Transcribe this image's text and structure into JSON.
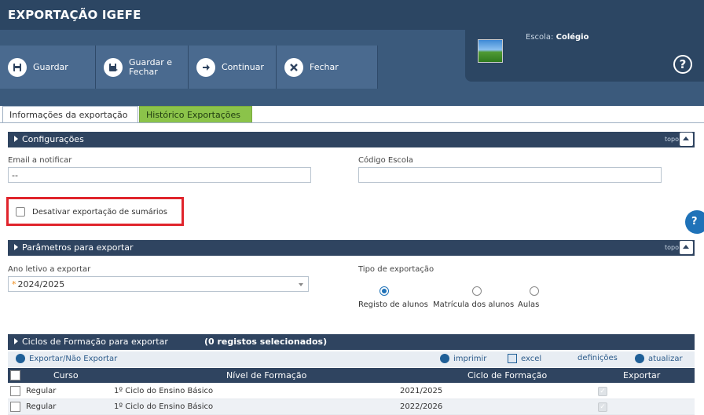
{
  "app": {
    "title": "EXPORTAÇÃO IGEFE"
  },
  "toolbar": {
    "save_label": "Guardar",
    "save_close_line1": "Guardar e",
    "save_close_line2": "Fechar",
    "continue_label": "Continuar",
    "close_label": "Fechar"
  },
  "school": {
    "label": "Escola:",
    "name": "Colégio",
    "help": "?"
  },
  "tabs": [
    {
      "label": "Informações da exportação"
    },
    {
      "label": "Histórico Exportações"
    }
  ],
  "sections": {
    "config": "Configurações",
    "params": "Parâmetros para exportar",
    "cycles": "Ciclos de Formação para exportar",
    "cycles_count": "(0 registos selecionados)",
    "topo": "topo"
  },
  "config": {
    "email_label": "Email a notificar",
    "email_value": "--",
    "code_label": "Código Escola",
    "code_value": "",
    "disable_summaries_label": "Desativar exportação de sumários"
  },
  "side_help": "?",
  "params": {
    "year_label": "Ano letivo a exportar",
    "year_required": "*",
    "year_value": "2024/2025",
    "type_label": "Tipo de exportação",
    "type_options": [
      "Registo de alunos",
      "Matrícula dos alunos",
      "Aulas"
    ],
    "type_selected": "Registo de alunos"
  },
  "table_toolbar": {
    "toggle_label": "Exportar/Não Exportar",
    "print_label": "imprimir",
    "excel_label": "excel",
    "settings_label": "definições",
    "refresh_label": "atualizar"
  },
  "table": {
    "columns": [
      "Curso",
      "Nível de Formação",
      "Ciclo de Formação",
      "Exportar"
    ],
    "rows": [
      {
        "curso": "Regular",
        "nivel": "1º Ciclo do Ensino Básico",
        "ciclo": "2021/2025",
        "exportar": "✓"
      },
      {
        "curso": "Regular",
        "nivel": "1º Ciclo do Ensino Básico",
        "ciclo": "2022/2026",
        "exportar": "✓"
      }
    ]
  },
  "colors": {
    "header": "#3b5a7c",
    "section": "#2f4460",
    "tab_green": "#8bc34a",
    "highlight": "#e0242c",
    "accent": "#1f72b8"
  }
}
